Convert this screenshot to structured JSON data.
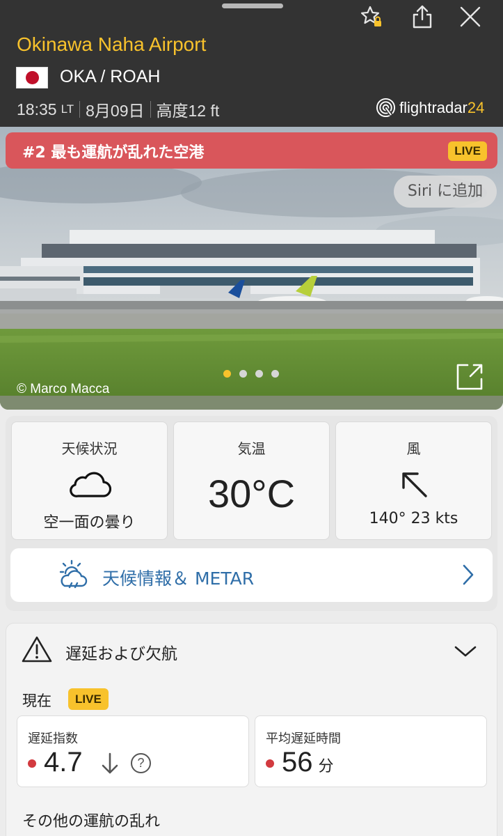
{
  "header": {
    "airport_name": "Okinawa Naha Airport",
    "codes": "OKA / ROAH",
    "time": "18:35",
    "time_zone": "LT",
    "date": "8月09日",
    "elevation": "高度12 ft",
    "brand": "flightradar",
    "brand_suffix": "24",
    "flag": "Japan"
  },
  "photo": {
    "banner": "#2 最も運航が乱れた空港",
    "live_label": "LIVE",
    "siri_label": "Siri に追加",
    "credit": "© Marco Macca",
    "active_slide": 1,
    "slide_count": 4
  },
  "weather": {
    "condition_label": "天候状況",
    "condition_value": "空一面の曇り",
    "temp_label": "気温",
    "temp_value": "30°C",
    "wind_label": "風",
    "wind_value": "140° 23 kts",
    "metar_label": "天候情報＆ METAR"
  },
  "delays": {
    "title": "遅延および欠航",
    "now_label": "現在",
    "live_label": "LIVE",
    "index_label": "遅延指数",
    "index_value": "4.7",
    "avg_label": "平均遅延時間",
    "avg_value": "56",
    "avg_unit": "分",
    "other_label": "その他の運航の乱れ"
  },
  "colors": {
    "accent": "#f8c22c",
    "header_bg": "#333333",
    "banner_red": "#d9565b",
    "link_blue": "#2f6ea8",
    "status_red": "#d23a3f"
  }
}
